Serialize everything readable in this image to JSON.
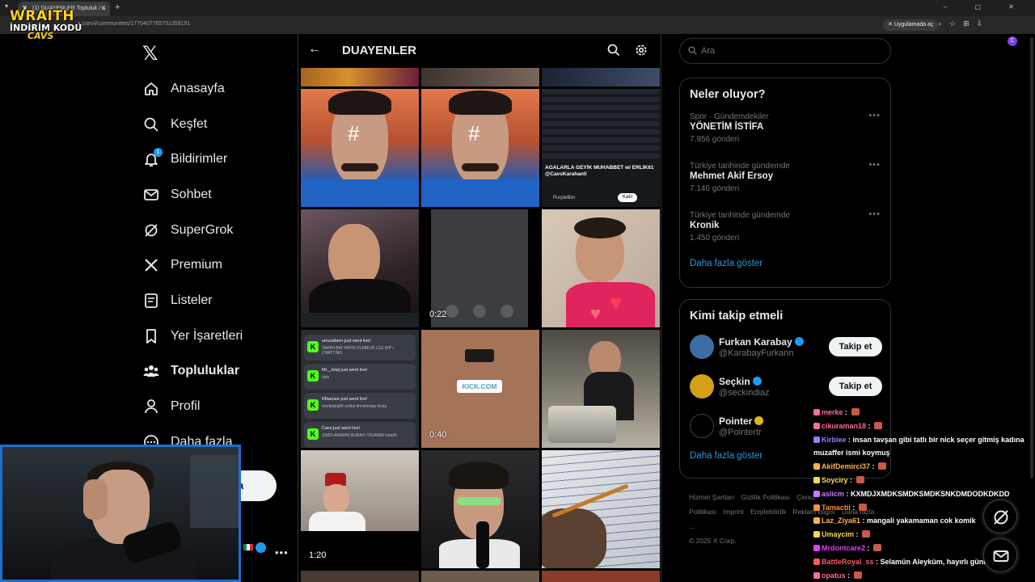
{
  "browser": {
    "tab_title": "(1) DUAYENLER Topluluk / X",
    "url": "x.com/i/communities/1770407765791359191",
    "app_pill": "Uygulamada aç"
  },
  "overlay_logo": {
    "line1": "WRAITH",
    "line2": "İNDİRİM KODU",
    "line3": "CAVS"
  },
  "nav": {
    "items": [
      {
        "label": "Anasayfa",
        "icon": "home-icon"
      },
      {
        "label": "Keşfet",
        "icon": "search-icon"
      },
      {
        "label": "Bildirimler",
        "icon": "bell-icon",
        "badge": "1"
      },
      {
        "label": "Sohbet",
        "icon": "mail-icon"
      },
      {
        "label": "SuperGrok",
        "icon": "grok-icon"
      },
      {
        "label": "Premium",
        "icon": "x-icon"
      },
      {
        "label": "Listeler",
        "icon": "list-icon"
      },
      {
        "label": "Yer İşaretleri",
        "icon": "bookmark-icon"
      },
      {
        "label": "Topluluklar",
        "icon": "communities-icon",
        "active": true
      },
      {
        "label": "Profil",
        "icon": "person-icon"
      },
      {
        "label": "Daha fazla",
        "icon": "more-circle-icon"
      }
    ],
    "post_label": "a"
  },
  "main": {
    "title": "DUAYENLER",
    "durations": [
      "0:22",
      "0:40",
      "1:20"
    ],
    "kick_label": "KICK.COM",
    "livestream_card": {
      "headline": "AGALARLA GEYİK MUHABBET w/ ERLIK61 @CavsKarahanli",
      "author": "PurpleBixi",
      "button": "Katıl"
    },
    "live_notifications": [
      {
        "title": "umurafann just went live!",
        "text": "TARİHİ BİR YAYIN OLABİLİR | GS WP • CHATTING"
      },
      {
        "title": "Mr._Jelal just went live!",
        "text": "öyle"
      },
      {
        "title": "Rflaenee just went live!",
        "text": "mertbaba06 online fincehesap linsta"
      },
      {
        "title": "Cavs just went live!",
        "text": "ŞİMDİ ARARIM BURAYI YIĞARIM !wraith"
      }
    ]
  },
  "search": {
    "placeholder": "Ara"
  },
  "trends": {
    "title": "Neler oluyor?",
    "items": [
      {
        "context": "Spor · Gündemdekiler",
        "name": "YÖNETİM İSTİFA",
        "count": "7.956 gönderi"
      },
      {
        "context": "Türkiye tarihinde gündemde",
        "name": "Mehmet Akif Ersoy",
        "count": "7.146 gönderi"
      },
      {
        "context": "Türkiye tarihinde gündemde",
        "name": "Kronik",
        "count": "1.450 gönderi"
      }
    ],
    "show_more": "Daha fazla göster"
  },
  "who_to_follow": {
    "title": "Kimi takip etmeli",
    "items": [
      {
        "name": "Furkan Karabay",
        "handle": "@KarabayFurkann",
        "button": "Takip et",
        "verified_color": "#1d9bf0"
      },
      {
        "name": "Seçkin",
        "handle": "@seckindiaz",
        "button": "Takip et",
        "verified_color": "#1d9bf0"
      },
      {
        "name": "Pointer",
        "handle": "@Pointertr",
        "verified_color": "#e2b719"
      }
    ],
    "show_more": "Daha fazla göster"
  },
  "footer": {
    "links": [
      "Hizmet Şartları",
      "Gizlilik Politikası",
      "Çerez Politikası",
      "Imprint",
      "Erişilebilirlik",
      "Reklam bilgisi",
      "Daha fazla ..."
    ],
    "copyright": "© 2025 X Corp."
  },
  "chat": [
    {
      "user": "merke",
      "msg": "",
      "color": "#ff6a9a"
    },
    {
      "user": "cikuraman18",
      "msg": "",
      "color": "#ff6a9a"
    },
    {
      "user": "Kirbiee",
      "msg": "insan tavşan gibi tatlı bir nick seçer gitmiş kadına muzaffer ismi koymuş",
      "color": "#9b7bff"
    },
    {
      "user": "AkifDemirci37",
      "msg": "",
      "color": "#ffb347"
    },
    {
      "user": "Soyciry",
      "msg": "",
      "color": "#ffd84a"
    },
    {
      "user": "aslicm",
      "msg": "KXMDJXMDKSMDKSMDKSNKDMDODKDKDD",
      "color": "#c77dff"
    },
    {
      "user": "Tamactii",
      "msg": "",
      "color": "#ff8c42"
    },
    {
      "user": "Laz_Ziya61",
      "msg": "mangali yakamaman cok komik",
      "color": "#ffb347"
    },
    {
      "user": "Umaycim",
      "msg": "",
      "color": "#ffd84a"
    },
    {
      "user": "Mrdontcare2",
      "msg": "",
      "color": "#e040fb"
    },
    {
      "user": "BattleRoyal_ss",
      "msg": "Selamün Aleyküm, hayırlı günler chat",
      "color": "#ff5a5a"
    },
    {
      "user": "opatus",
      "msg": "",
      "color": "#ff6a9a"
    }
  ],
  "colors": {
    "accent": "#1d9bf0",
    "background": "#000000",
    "border": "#2f3336"
  }
}
